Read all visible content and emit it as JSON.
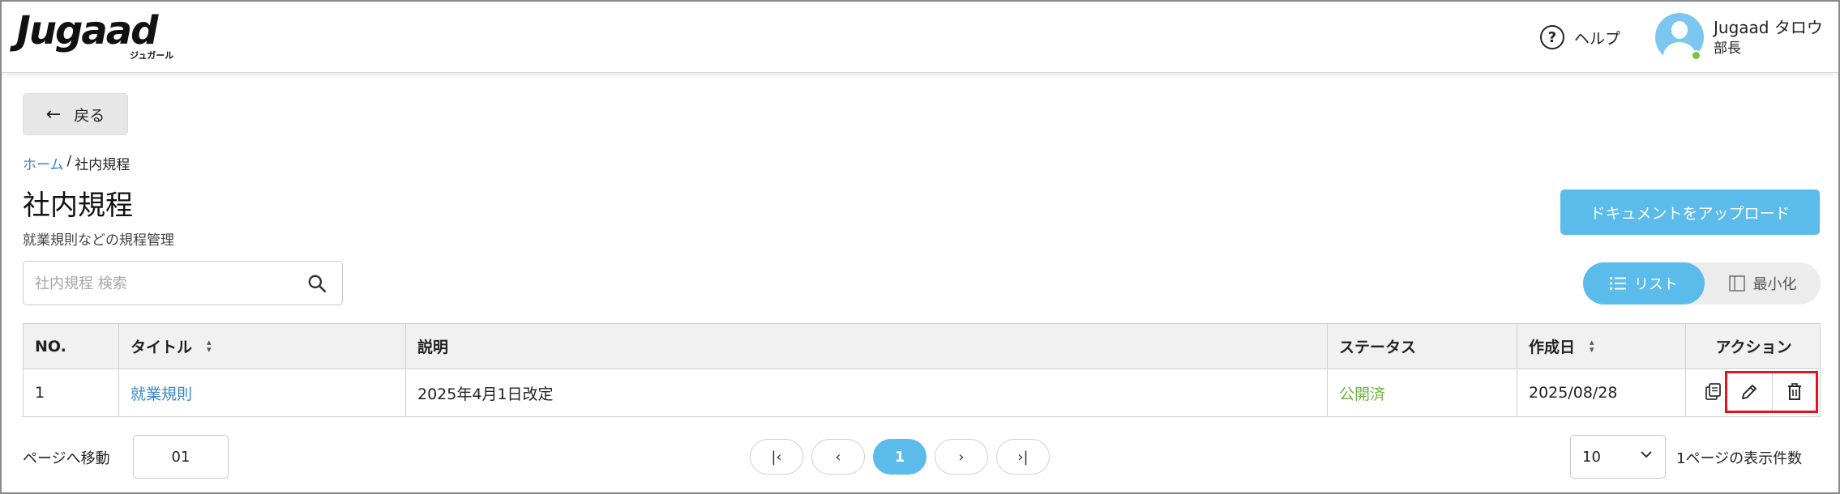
{
  "header": {
    "logo_text": "Jugaad",
    "logo_sub": "ジュガール",
    "help_label": "ヘルプ",
    "user_name": "Jugaad タロウ",
    "user_role": "部長"
  },
  "nav": {
    "back_label": "戻る",
    "breadcrumb": {
      "home": "ホーム",
      "separator": "/",
      "current": "社内規程"
    }
  },
  "page": {
    "title": "社内規程",
    "subtitle": "就業規則などの規程管理",
    "upload_label": "ドキュメントをアップロード"
  },
  "search": {
    "placeholder": "社内規程 検索",
    "value": ""
  },
  "view_toggle": {
    "list_label": "リスト",
    "min_label": "最小化",
    "selected": "リスト"
  },
  "table": {
    "headers": {
      "no": "NO.",
      "title": "タイトル",
      "desc": "説明",
      "status": "ステータス",
      "date": "作成日",
      "action": "アクション"
    },
    "rows": [
      {
        "no": "1",
        "title": "就業規則",
        "desc": "2025年4月1日改定",
        "status": "公開済",
        "date": "2025/08/28"
      }
    ]
  },
  "pagination": {
    "goto_label": "ページへ移動",
    "goto_value": "01",
    "current_page": "1",
    "per_page_value": "10",
    "per_page_label": "1ページの表示件数"
  },
  "colors": {
    "accent": "#5bbbea",
    "link": "#3a86c8",
    "status_published": "#6db33f",
    "highlight_box": "#e5111b"
  },
  "icons": [
    "help-circle-icon",
    "user-avatar-icon",
    "arrow-left-icon",
    "search-icon",
    "list-icon",
    "sidebar-panel-icon",
    "sort-icon",
    "copy-icon",
    "edit-pencil-icon",
    "trash-icon",
    "first-page-icon",
    "prev-page-icon",
    "next-page-icon",
    "last-page-icon",
    "chevron-down-icon"
  ]
}
